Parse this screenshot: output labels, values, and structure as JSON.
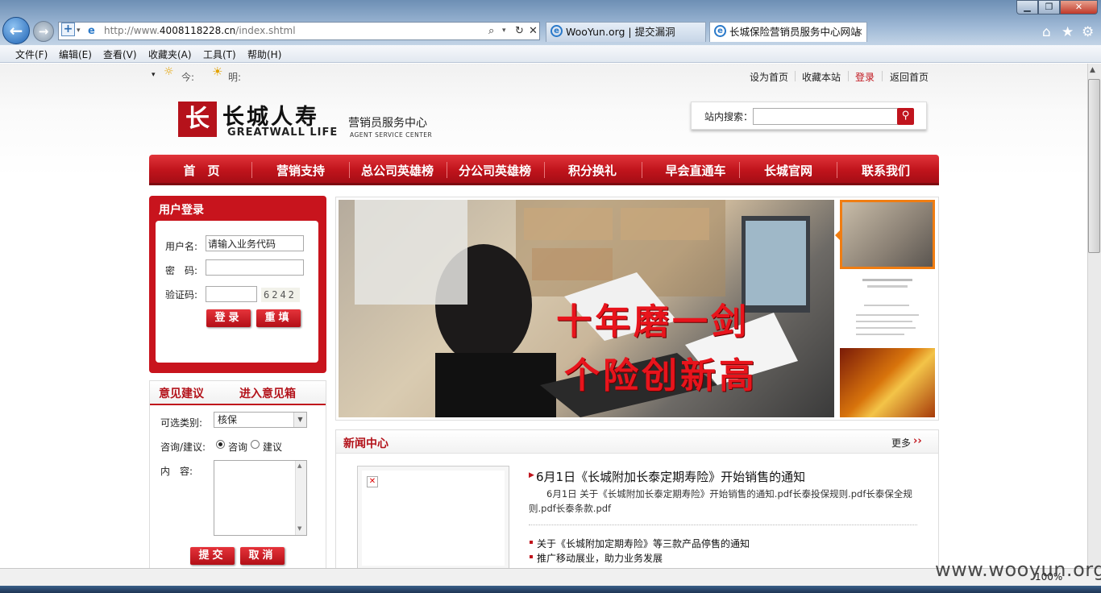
{
  "browser": {
    "url_prefix": "http://www.",
    "url_host": "4008118228.cn",
    "url_path": "/index.shtml",
    "tabs": [
      {
        "label": "WooYun.org | 提交漏洞"
      },
      {
        "label": "长城保险营销员服务中心网站"
      }
    ],
    "menu": [
      "文件(F)",
      "编辑(E)",
      "查看(V)",
      "收藏夹(A)",
      "工具(T)",
      "帮助(H)"
    ],
    "zoom": "100%",
    "watermark": "www.wooyun.org"
  },
  "topbar": {
    "weather_today": "今:",
    "weather_tomorrow": "明:",
    "links": [
      "设为首页",
      "收藏本站",
      "登录",
      "返回首页"
    ],
    "login_color": "#c0141c"
  },
  "header": {
    "logo_mark": "长",
    "logo_cn": "长城人寿",
    "logo_en": "GREATWALL LIFE",
    "logo_sub_cn": "营销员服务中心",
    "logo_sub_en": "AGENT SERVICE CENTER",
    "search_label": "站内搜索："
  },
  "nav": [
    "首　页",
    "营销支持",
    "总公司英雄榜",
    "分公司英雄榜",
    "积分换礼",
    "早会直通车",
    "长城官网",
    "联系我们"
  ],
  "login": {
    "title": "用户登录",
    "username_label": "用户名:",
    "username_value": "请输入业务代码",
    "password_label": "密　码:",
    "captcha_label": "验证码:",
    "captcha_text": "6242",
    "login_button": "登录",
    "reset_button": "重填"
  },
  "feedback": {
    "tab1": "意见建议",
    "tab2": "进入意见箱",
    "category_label": "可选类别:",
    "category_value": "核保",
    "type_label": "咨询/建议:",
    "type_options": [
      "咨询",
      "建议"
    ],
    "content_label": "内　容:",
    "submit_button": "提交",
    "cancel_button": "取消"
  },
  "banner": {
    "line1": "十年磨一剑",
    "line2": "个险创新高"
  },
  "news": {
    "title": "新闻中心",
    "more": "更多",
    "more_arrow": "››",
    "headline": "6月1日《长城附加长泰定期寿险》开始销售的通知",
    "description": "6月1日 关于《长城附加长泰定期寿险》开始销售的通知.pdf长泰投保规则.pdf长泰保全规则.pdf长泰条款.pdf",
    "items": [
      "关于《长城附加定期寿险》等三款产品停售的通知",
      "推广移动展业，助力业务发展"
    ]
  },
  "colors": {
    "brand_red": "#c0141c",
    "accent_orange": "#f07d12"
  }
}
